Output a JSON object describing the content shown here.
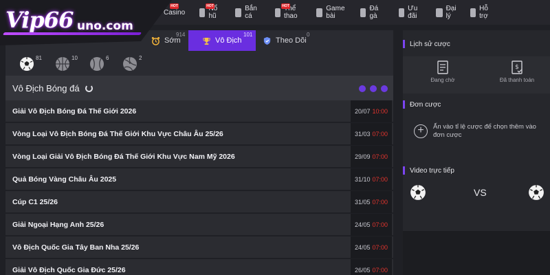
{
  "brand": {
    "logo_main": "Vip66",
    "logo_sub": "uno.com"
  },
  "nav": [
    {
      "label": "Casino",
      "icon": "casino-icon",
      "hot": true
    },
    {
      "label": "Nổ hũ",
      "icon": "slot-icon",
      "hot": true
    },
    {
      "label": "Bắn cá",
      "icon": "fish-icon",
      "hot": false
    },
    {
      "label": "Thể thao",
      "icon": "sports-icon",
      "hot": true
    },
    {
      "label": "Game bài",
      "icon": "cards-icon",
      "hot": false
    },
    {
      "label": "Đá gà",
      "icon": "rooster-icon",
      "hot": false
    },
    {
      "label": "Ưu đãi",
      "icon": "gift-icon",
      "hot": false
    },
    {
      "label": "Đại lý",
      "icon": "agent-icon",
      "hot": false
    },
    {
      "label": "Hỗ trợ",
      "icon": "support-icon",
      "hot": false
    }
  ],
  "hot_label": "HOT",
  "tabs": [
    {
      "label": "Sớm",
      "count": "914",
      "icon": "alarm-clock-icon"
    },
    {
      "label": "Vô Địch",
      "count": "101",
      "icon": "trophy-icon"
    },
    {
      "label": "Theo Dõi",
      "count": "0",
      "icon": "shield-icon"
    }
  ],
  "sports": [
    {
      "icon": "soccer-ball-icon",
      "count": "81"
    },
    {
      "icon": "basketball-icon",
      "count": "10"
    },
    {
      "icon": "tennis-ball-icon",
      "count": "6"
    },
    {
      "icon": "volleyball-icon",
      "count": "2"
    }
  ],
  "section": {
    "title": "Vô Địch Bóng đá"
  },
  "leagues": [
    {
      "name": "Giải Vô Địch Bóng Đá Thế Giới 2026",
      "date": "20/07",
      "time": "10:00"
    },
    {
      "name": "Vòng Loại Vô Địch Bóng Đá Thế Giới Khu Vực Châu Âu 25/26",
      "date": "31/03",
      "time": "07:00"
    },
    {
      "name": "Vòng Loại Giải Vô Địch Bóng Đá Thế Giới Khu Vực Nam Mỹ 2026",
      "date": "29/09",
      "time": "07:00"
    },
    {
      "name": "Quả Bóng Vàng Châu Âu 2025",
      "date": "31/10",
      "time": "07:00"
    },
    {
      "name": "Cúp C1 25/26",
      "date": "31/05",
      "time": "07:00"
    },
    {
      "name": "Giải Ngoại Hạng Anh 25/26",
      "date": "24/05",
      "time": "07:00"
    },
    {
      "name": "Vô Địch Quốc Gia Tây Ban Nha 25/26",
      "date": "24/05",
      "time": "07:00"
    },
    {
      "name": "Giải Vô Địch Quốc Gia Đức 25/26",
      "date": "26/05",
      "time": "07:00"
    }
  ],
  "history": {
    "title": "Lịch sử cược",
    "pending": "Đang chờ",
    "paid": "Đã thanh toán"
  },
  "betslip": {
    "title": "Đơn cược",
    "hint": "Ấn vào tỉ lệ cược để chọn thêm vào đơn cược"
  },
  "live": {
    "title": "Video trực tiếp",
    "vs": "VS"
  },
  "colors": {
    "accent": "#6a2ee0",
    "time_red": "#e0342e",
    "background": "#1f2025"
  }
}
